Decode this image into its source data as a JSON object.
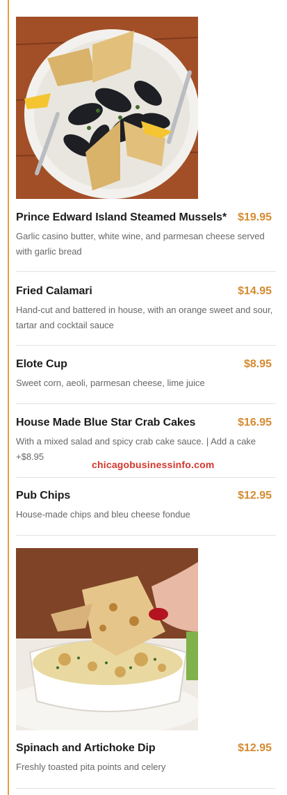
{
  "watermark": "chicagobusinessinfo.com",
  "colors": {
    "accent": "#e39b45",
    "price": "#d58a2f",
    "watermark": "#d3362b"
  },
  "images": [
    {
      "name": "mussels-photo",
      "alt": "Plate of steamed mussels with garlic bread and lemon"
    },
    {
      "name": "spinach-dip-photo",
      "alt": "Spinach and artichoke dip with pita points"
    }
  ],
  "menu_items": [
    {
      "name": "Prince Edward Island Steamed Mussels*",
      "price": "$19.95",
      "description": "Garlic casino butter, white wine, and parmesan cheese served with garlic bread"
    },
    {
      "name": "Fried Calamari",
      "price": "$14.95",
      "description": "Hand-cut and battered in house, with an orange sweet and sour, tartar and cocktail sauce"
    },
    {
      "name": "Elote Cup",
      "price": "$8.95",
      "description": "Sweet corn, aeoli, parmesan cheese, lime juice"
    },
    {
      "name": "House Made Blue Star Crab Cakes",
      "price": "$16.95",
      "description": "With a mixed salad and spicy crab cake sauce. | Add a cake +$8.95"
    },
    {
      "name": "Pub Chips",
      "price": "$12.95",
      "description": "House-made chips and bleu cheese fondue"
    },
    {
      "name": "Spinach and Artichoke Dip",
      "price": "$12.95",
      "description": "Freshly toasted pita points and celery"
    }
  ]
}
